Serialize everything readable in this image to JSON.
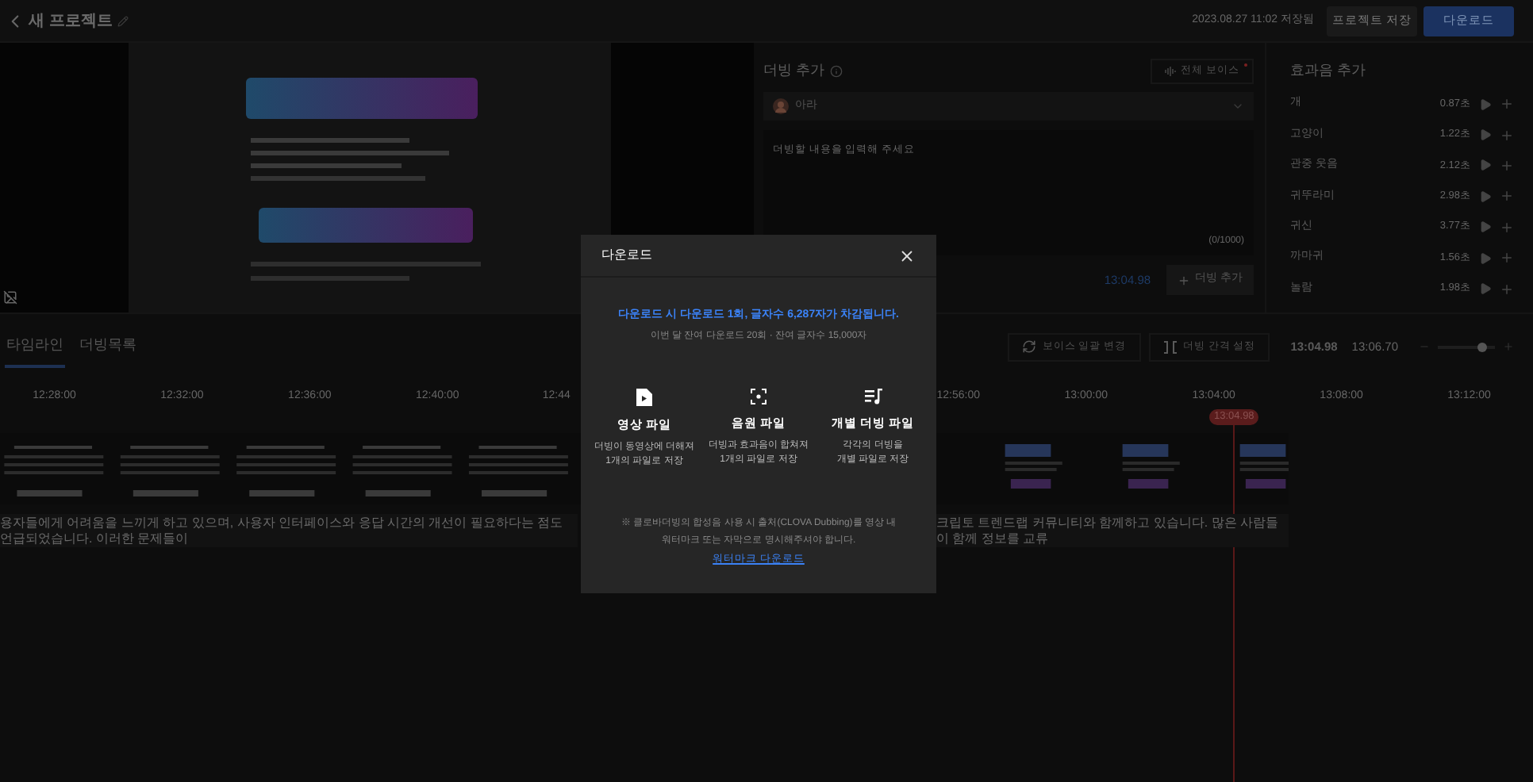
{
  "header": {
    "title": "새 프로젝트",
    "saved_at": "2023.08.27 11:02 저장됨",
    "buttons": [
      {
        "label": "프로젝트 저장",
        "kind": "secondary"
      },
      {
        "label": "다운로드",
        "kind": "primary"
      }
    ]
  },
  "dubbing": {
    "title": "더빙 추가",
    "voice_all_button": "전체 보이스",
    "voice": "아라",
    "placeholder": "더빙할 내용을 입력해 주세요",
    "counter": "(0/1000)",
    "time": "13:04.98",
    "add_button": "더빙 추가"
  },
  "effects": {
    "title": "효과음 추가",
    "items": [
      {
        "name": "개",
        "duration": "0.87초"
      },
      {
        "name": "고양이",
        "duration": "1.22초"
      },
      {
        "name": "관중 웃음",
        "duration": "2.12초"
      },
      {
        "name": "귀뚜라미",
        "duration": "2.98초"
      },
      {
        "name": "귀신",
        "duration": "3.77초"
      },
      {
        "name": "까마귀",
        "duration": "1.56초"
      },
      {
        "name": "놀람",
        "duration": "1.98초"
      }
    ]
  },
  "timeline": {
    "tabs": [
      {
        "label": "타임라인",
        "selected": true
      },
      {
        "label": "더빙목록",
        "selected": false
      }
    ],
    "tools": [
      {
        "label": "보이스 일괄 변경",
        "kind": "voice"
      },
      {
        "label": "더빙 간격 설정",
        "kind": "gap"
      }
    ],
    "current_time": "13:04.98",
    "end_time": "13:06.70",
    "zoom": {
      "level": 0.78
    },
    "ticks_left": [
      "12:28:00",
      "12:32:00",
      "12:36:00",
      "12:40:00",
      "12:44"
    ],
    "ticks_right": [
      "12:56:00",
      "13:00:00",
      "13:04:00",
      "13:08:00",
      "13:12:00"
    ],
    "playhead": "13:04.98",
    "captions": [
      "용자들에게 어려움을 느끼게 하고 있으며, 사용자 인터페이스와 응답 시간의 개선이 필요하다는 점도 언급되었습니다. 이러한 문제들이",
      "크립토 트렌드랩 커뮤니티와 함께하고 있습니다. 많은 사람들이 함께 정보를 교류"
    ]
  },
  "modal": {
    "title": "다운로드",
    "notice": "다운로드 시 다운로드 1회, 글자수 6,287자가 차감됩니다.",
    "remaining": "이번 달 잔여 다운로드 20회 · 잔여 글자수 15,000자",
    "options": [
      {
        "kind": "video",
        "title": "영상 파일",
        "lines": [
          "더빙이 동영상에 더해져",
          "1개의 파일로 저장"
        ]
      },
      {
        "kind": "audio",
        "title": "음원 파일",
        "lines": [
          "더빙과 효과음이 합쳐져",
          "1개의 파일로 저장"
        ]
      },
      {
        "kind": "individual",
        "title": "개별 더빙 파일",
        "lines": [
          "각각의 더빙을",
          "개별 파일로 저장"
        ]
      }
    ],
    "note_lines": [
      "※ 클로바더빙의 합성음 사용 시 출처(CLOVA Dubbing)를 영상 내",
      "워터마크 또는 자막으로 명시해주셔야 합니다."
    ],
    "link": "워터마크 다운로드"
  }
}
